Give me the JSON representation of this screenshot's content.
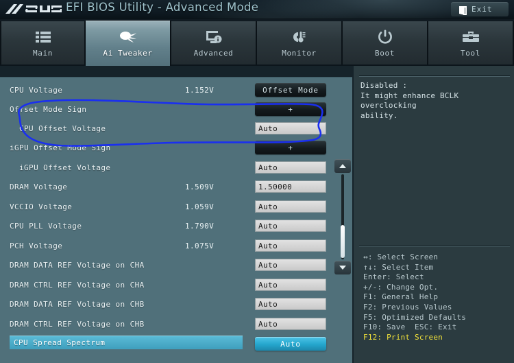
{
  "titlebar": {
    "logo_text": "ASUS",
    "title": "EFI BIOS Utility - Advanced Mode",
    "exit_label": "Exit",
    "exit_icon": "exit-door-icon"
  },
  "tabs": [
    {
      "label": "Main",
      "icon": "list-icon",
      "active": false
    },
    {
      "label": "Ai Tweaker",
      "icon": "tuning-knob-icon",
      "active": true
    },
    {
      "label": "Advanced",
      "icon": "monitor-info-icon",
      "active": false
    },
    {
      "label": "Monitor",
      "icon": "thermometer-icon",
      "active": false
    },
    {
      "label": "Boot",
      "icon": "power-icon",
      "active": false
    },
    {
      "label": "Tool",
      "icon": "toolbox-icon",
      "active": false
    }
  ],
  "settings": {
    "rows": [
      {
        "label": "CPU Voltage",
        "value": "1.152V",
        "control": "button",
        "control_value": "Offset Mode",
        "indent": false,
        "selected": false
      },
      {
        "label": "Offset Mode Sign",
        "value": "",
        "control": "button",
        "control_value": "+",
        "indent": false,
        "selected": false
      },
      {
        "label": "CPU Offset Voltage",
        "value": "",
        "control": "input",
        "control_value": "Auto",
        "indent": true,
        "selected": false
      },
      {
        "label": "iGPU Offset Mode Sign",
        "value": "",
        "control": "button",
        "control_value": "+",
        "indent": false,
        "selected": false
      },
      {
        "label": "iGPU Offset Voltage",
        "value": "",
        "control": "input",
        "control_value": "Auto",
        "indent": true,
        "selected": false
      },
      {
        "label": "DRAM Voltage",
        "value": "1.509V",
        "control": "input",
        "control_value": "1.50000",
        "indent": false,
        "selected": false
      },
      {
        "label": "VCCIO Voltage",
        "value": "1.059V",
        "control": "input",
        "control_value": "Auto",
        "indent": false,
        "selected": false
      },
      {
        "label": "CPU PLL Voltage",
        "value": "1.790V",
        "control": "input",
        "control_value": "Auto",
        "indent": false,
        "selected": false
      },
      {
        "label": "PCH Voltage",
        "value": "1.075V",
        "control": "input",
        "control_value": "Auto",
        "indent": false,
        "selected": false
      },
      {
        "label": "DRAM DATA REF Voltage on CHA",
        "value": "",
        "control": "input",
        "control_value": "Auto",
        "indent": false,
        "selected": false
      },
      {
        "label": "DRAM CTRL REF Voltage on CHA",
        "value": "",
        "control": "input",
        "control_value": "Auto",
        "indent": false,
        "selected": false
      },
      {
        "label": "DRAM DATA REF Voltage on CHB",
        "value": "",
        "control": "input",
        "control_value": "Auto",
        "indent": false,
        "selected": false
      },
      {
        "label": "DRAM CTRL REF Voltage on CHB",
        "value": "",
        "control": "input",
        "control_value": "Auto",
        "indent": false,
        "selected": false
      },
      {
        "label": "CPU Spread Spectrum",
        "value": "",
        "control": "button",
        "control_value": "Auto",
        "indent": false,
        "selected": true
      }
    ]
  },
  "scrollbar": {
    "up_icon": "scroll-up-arrow-icon",
    "down_icon": "scroll-down-arrow-icon"
  },
  "help": {
    "text": "Disabled :\nIt might enhance BCLK overclocking\nability."
  },
  "legend": {
    "lines": [
      {
        "text": "↔: Select Screen",
        "highlight": false
      },
      {
        "text": "↑↓: Select Item",
        "highlight": false
      },
      {
        "text": "Enter: Select",
        "highlight": false
      },
      {
        "text": "+/-: Change Opt.",
        "highlight": false
      },
      {
        "text": "F1: General Help",
        "highlight": false
      },
      {
        "text": "F2: Previous Values",
        "highlight": false
      },
      {
        "text": "F5: Optimized Defaults",
        "highlight": false
      },
      {
        "text": "F10: Save  ESC: Exit",
        "highlight": false
      },
      {
        "text": "F12: Print Screen",
        "highlight": true
      }
    ]
  },
  "annotation": {
    "color": "#1a2ff0",
    "shape": "hand-drawn-ellipse-loop",
    "encircles": [
      "Offset Mode Sign",
      "CPU Offset Voltage"
    ]
  },
  "colors": {
    "panel_bg": "#50707a",
    "sidebar_bg": "#2b3b40",
    "titlebar_bg": "#101c24",
    "accent_cyan": "#3f9fbd",
    "highlight_yellow": "#f2e23a",
    "annotation_blue": "#1a2ff0"
  }
}
